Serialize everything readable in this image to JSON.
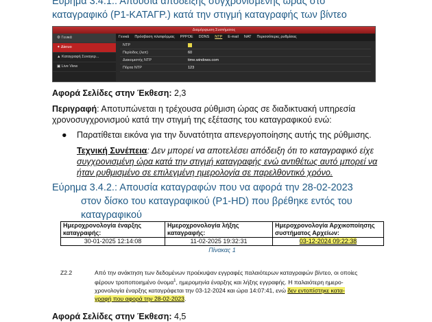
{
  "finding1": {
    "title_line1": "Εύρημα 3.4.1.:    Απουσία απόδειξης συγχρονισμένης ώρας στο",
    "title_line2": "καταγραφικό (P1-ΚΑΤΑΓΡ.) κατά την στιγμή καταγραφής των βίντεο"
  },
  "screenshot": {
    "header": "Διαμόρφωση Συστήματος",
    "left_general": "Γενικά",
    "left_items": [
      "Δίκτυο",
      "Καταγραφή Συναγερ...",
      "Live View"
    ],
    "tabs": [
      "Γενικά",
      "Πρόσβαση πλατφόρμας",
      "PPPOE",
      "DDNS",
      "NTP",
      "E-mail",
      "NAT",
      "Περισσότερες ρυθμίσεις"
    ],
    "rows": [
      {
        "label": "NTP",
        "value": ""
      },
      {
        "label": "Περίοδος (λεπ)",
        "value": "60"
      },
      {
        "label": "Διακομιστής NTP",
        "value": "time.windows.com"
      },
      {
        "label": "Πόρτα NTP",
        "value": "123"
      }
    ]
  },
  "affects1": {
    "label": "Αφορά Σελίδες στην Έκθεση:",
    "value": " 2,3"
  },
  "description": {
    "label": "Περιγραφή",
    "line1": ": Αποτυπώνεται η τρέχουσα ρύθμιση ώρας σε διαδικτυακή υπηρεσία",
    "line2": "χρονοσυγχρονισμού κατά την στιγμή της εξέτασης του καταγραφικού ενώ:"
  },
  "bullet1": "Παρατίθεται εικόνα για την δυνατότητα απενεργοποίησης αυτής της ρύθμισης.",
  "consequence": {
    "label": "Τεχνική Συνέπεια",
    "line1": ": Δεν μπορεί να αποτελέσει απόδειξη ότι το καταγραφικό είχε",
    "line2": "συγχρονισμένη ώρα κατά την στιγμή καταγραφής ενώ αντιθέτως αυτό μπορεί να",
    "line3": "ήταν ρυθμισμένο σε επιλεγμένη ημερολογία σε παρελθοντικό χρόνο."
  },
  "finding2": {
    "title_line1": "Εύρημα 3.4.2.:    Απουσία καταγραφών που να αφορά την 28-02-2023",
    "title_line2": "στον δίσκο του καταγραφικού (P1-HD) που βρέθηκε εντός του",
    "title_line3": "καταγραφικού"
  },
  "table": {
    "headers": [
      "Ημεροχρονολογία έναρξης καταγραφής:",
      "Ημεροχρονολογία λήξης καταγραφής:",
      "Ημεροχρονολογία Αρχικοποίησης συστήματος Αρχείων:"
    ],
    "row": [
      "30-01-2025 12:14:08",
      "11-02-2025 19:32:31",
      "03-12-2024 09:22:38"
    ],
    "caption": "Πίνακας 1"
  },
  "z22": {
    "num": "Z2.2",
    "line1": "Από την ανάκτηση των δεδομένων προέκυψαν εγγραφές παλαιότερων καταγραφών βίντεο, οι οποίες",
    "line2a": "φέρουν τροποποιημένο όνομα",
    "sup": "1",
    "line2b": ", ημερομηνία έναρξης και λήξης εγγραφής. Η παλαιότερη ημερο-",
    "line3a": "χρονολογία έναρξης καταγράφεται την 03-12-2024 και ώρα 14:07:41, ενώ ",
    "line3b": "δεν εντοπίστηκε κατα-",
    "line4": "γραφή που αφορά την 28-02-2023",
    "line4end": "."
  },
  "affects2": {
    "label": "Αφορά Σελίδες στην Έκθεση:",
    "value": " 4,5"
  }
}
